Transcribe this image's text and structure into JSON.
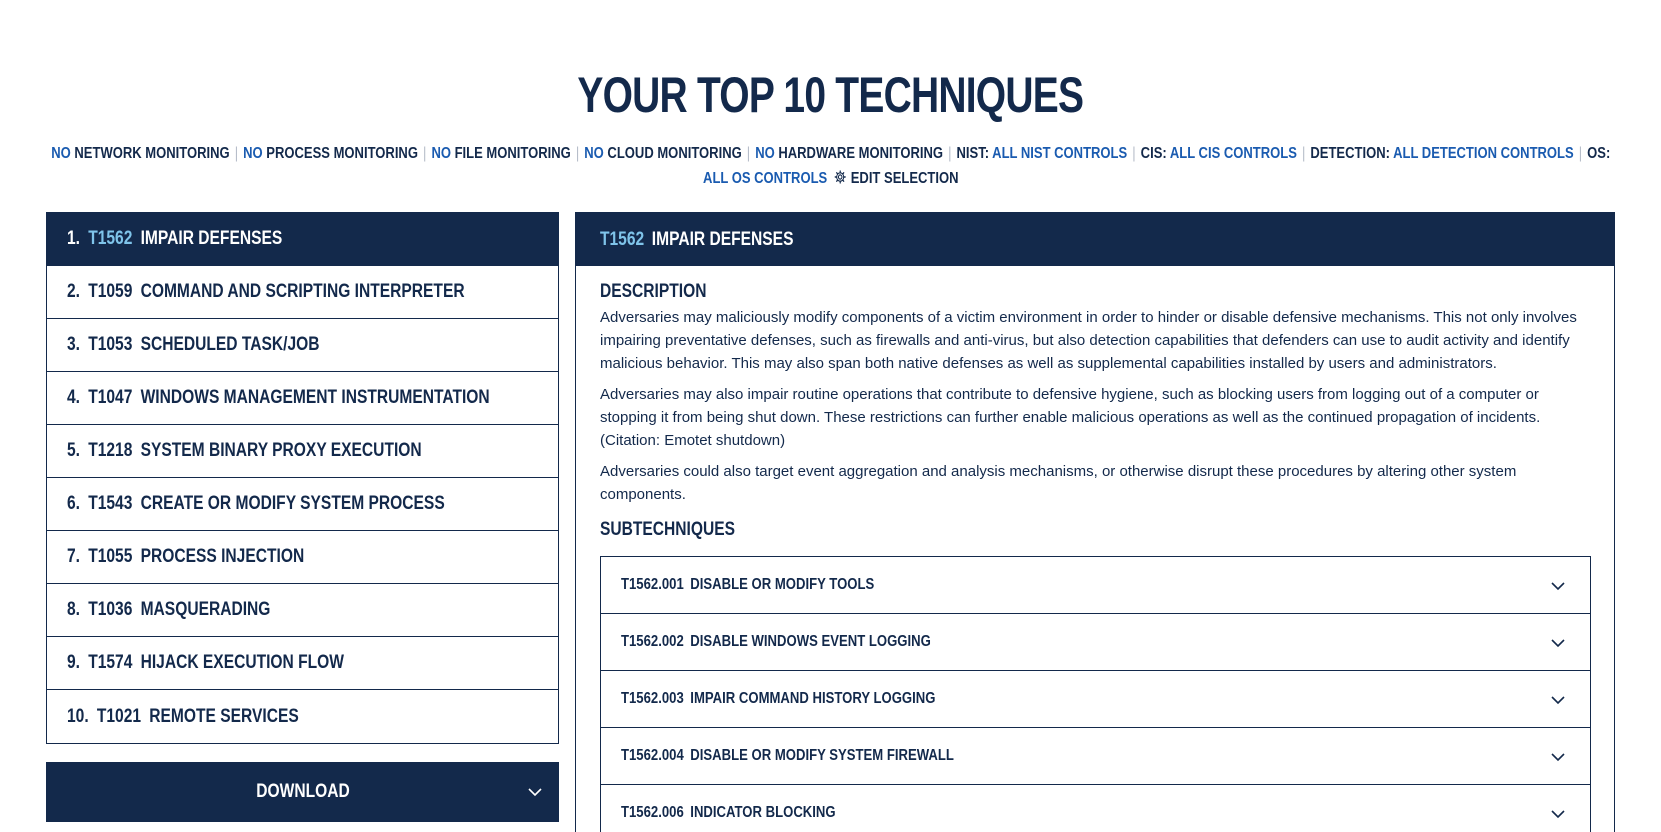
{
  "page": {
    "title": "YOUR TOP 10 TECHNIQUES"
  },
  "filters": {
    "items": [
      {
        "prefix": "NO",
        "label": "NETWORK MONITORING"
      },
      {
        "prefix": "NO",
        "label": "PROCESS MONITORING"
      },
      {
        "prefix": "NO",
        "label": "FILE MONITORING"
      },
      {
        "prefix": "NO",
        "label": "CLOUD MONITORING"
      },
      {
        "prefix": "NO",
        "label": "HARDWARE MONITORING"
      }
    ],
    "nist_label": "NIST:",
    "nist_value": "ALL NIST CONTROLS",
    "cis_label": "CIS:",
    "cis_value": "ALL CIS CONTROLS",
    "detection_label": "DETECTION:",
    "detection_value": "ALL DETECTION CONTROLS",
    "os_label": "OS:",
    "os_value": "ALL OS CONTROLS",
    "edit_label": "EDIT SELECTION",
    "separator": "|"
  },
  "techniques": [
    {
      "num": "1.",
      "id": "T1562",
      "name": "IMPAIR DEFENSES"
    },
    {
      "num": "2.",
      "id": "T1059",
      "name": "COMMAND AND SCRIPTING INTERPRETER"
    },
    {
      "num": "3.",
      "id": "T1053",
      "name": "SCHEDULED TASK/JOB"
    },
    {
      "num": "4.",
      "id": "T1047",
      "name": "WINDOWS MANAGEMENT INSTRUMENTATION"
    },
    {
      "num": "5.",
      "id": "T1218",
      "name": "SYSTEM BINARY PROXY EXECUTION"
    },
    {
      "num": "6.",
      "id": "T1543",
      "name": "CREATE OR MODIFY SYSTEM PROCESS"
    },
    {
      "num": "7.",
      "id": "T1055",
      "name": "PROCESS INJECTION"
    },
    {
      "num": "8.",
      "id": "T1036",
      "name": "MASQUERADING"
    },
    {
      "num": "9.",
      "id": "T1574",
      "name": "HIJACK EXECUTION FLOW"
    },
    {
      "num": "10.",
      "id": "T1021",
      "name": "REMOTE SERVICES"
    }
  ],
  "download": {
    "label": "DOWNLOAD"
  },
  "detail": {
    "id": "T1562",
    "name": "IMPAIR DEFENSES",
    "description_heading": "DESCRIPTION",
    "paragraphs": [
      "Adversaries may maliciously modify components of a victim environment in order to hinder or disable defensive mechanisms. This not only involves impairing preventative defenses, such as firewalls and anti-virus, but also detection capabilities that defenders can use to audit activity and identify malicious behavior. This may also span both native defenses as well as supplemental capabilities installed by users and administrators.",
      "Adversaries may also impair routine operations that contribute to defensive hygiene, such as blocking users from logging out of a computer or stopping it from being shut down. These restrictions can further enable malicious operations as well as the continued propagation of incidents. (Citation: Emotet shutdown)",
      "Adversaries could also target event aggregation and analysis mechanisms, or otherwise disrupt these procedures by altering other system components."
    ],
    "subtechniques_heading": "SUBTECHNIQUES",
    "subtechniques": [
      {
        "id": "T1562.001",
        "name": "DISABLE OR MODIFY TOOLS"
      },
      {
        "id": "T1562.002",
        "name": "DISABLE WINDOWS EVENT LOGGING"
      },
      {
        "id": "T1562.003",
        "name": "IMPAIR COMMAND HISTORY LOGGING"
      },
      {
        "id": "T1562.004",
        "name": "DISABLE OR MODIFY SYSTEM FIREWALL"
      },
      {
        "id": "T1562.006",
        "name": "INDICATOR BLOCKING"
      }
    ]
  },
  "colors": {
    "navy": "#13294b",
    "link_blue": "#1a5bb0",
    "active_id": "#7fc4ea",
    "separator": "#b5bcc8"
  }
}
